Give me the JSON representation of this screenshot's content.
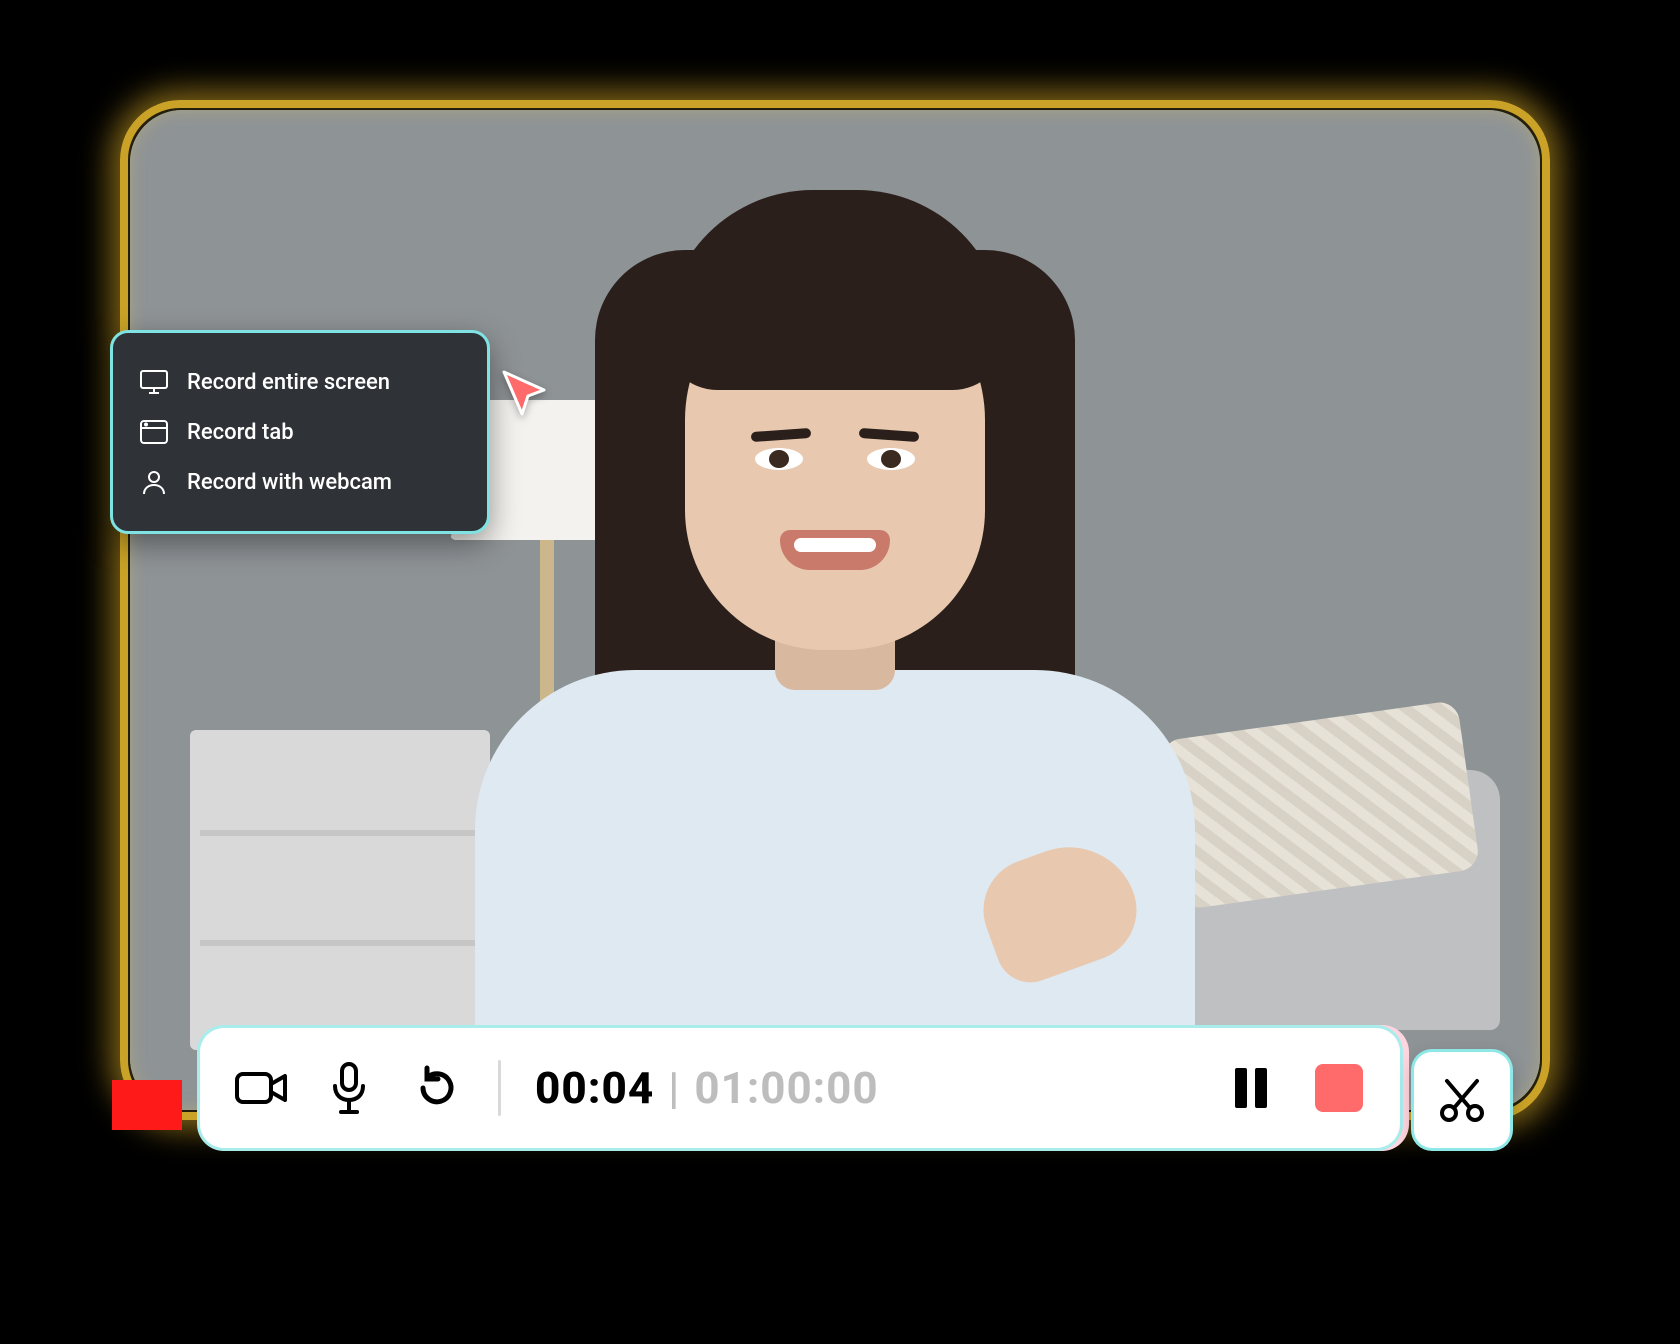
{
  "popup": {
    "items": [
      {
        "icon": "monitor-icon",
        "label": "Record entire screen"
      },
      {
        "icon": "tab-icon",
        "label": "Record tab"
      },
      {
        "icon": "person-icon",
        "label": "Record with webcam"
      }
    ]
  },
  "toolbar": {
    "camera_icon": "camera-icon",
    "mic_icon": "microphone-icon",
    "restart_icon": "restart-icon",
    "elapsed": "00:04",
    "separator": "|",
    "total": "01:00:00",
    "pause_icon": "pause-icon",
    "stop_icon": "stop-icon",
    "stop_color": "#ff6b6b"
  },
  "trim": {
    "icon": "scissors-icon"
  },
  "cursor": {
    "color": "#ff6b6b"
  },
  "colors": {
    "frame_glow": "#c9a227",
    "popup_bg": "#2f3236",
    "accent_teal": "#7fe3e3",
    "accent_pink": "#ffd1dc"
  }
}
